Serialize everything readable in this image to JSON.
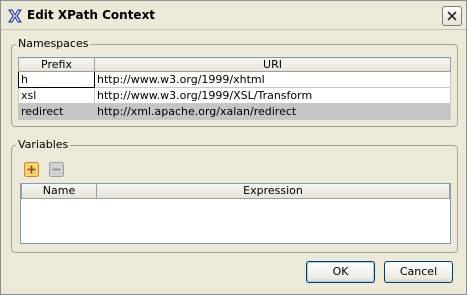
{
  "window": {
    "title": "Edit XPath Context"
  },
  "namespaces": {
    "legend": "Namespaces",
    "columns": [
      "Prefix",
      "URI"
    ],
    "rows": [
      {
        "prefix": "h",
        "uri": "http://www.w3.org/1999/xhtml"
      },
      {
        "prefix": "xsl",
        "uri": "http://www.w3.org/1999/XSL/Transform"
      },
      {
        "prefix": "redirect",
        "uri": "http://xml.apache.org/xalan/redirect"
      }
    ]
  },
  "variables": {
    "legend": "Variables",
    "columns": [
      "Name",
      "Expression"
    ]
  },
  "buttons": {
    "ok": "OK",
    "cancel": "Cancel"
  },
  "colors": {
    "add_icon": "#e8a33a",
    "remove_icon": "#a0a0a0",
    "selected_row": "#c5c5c5"
  }
}
